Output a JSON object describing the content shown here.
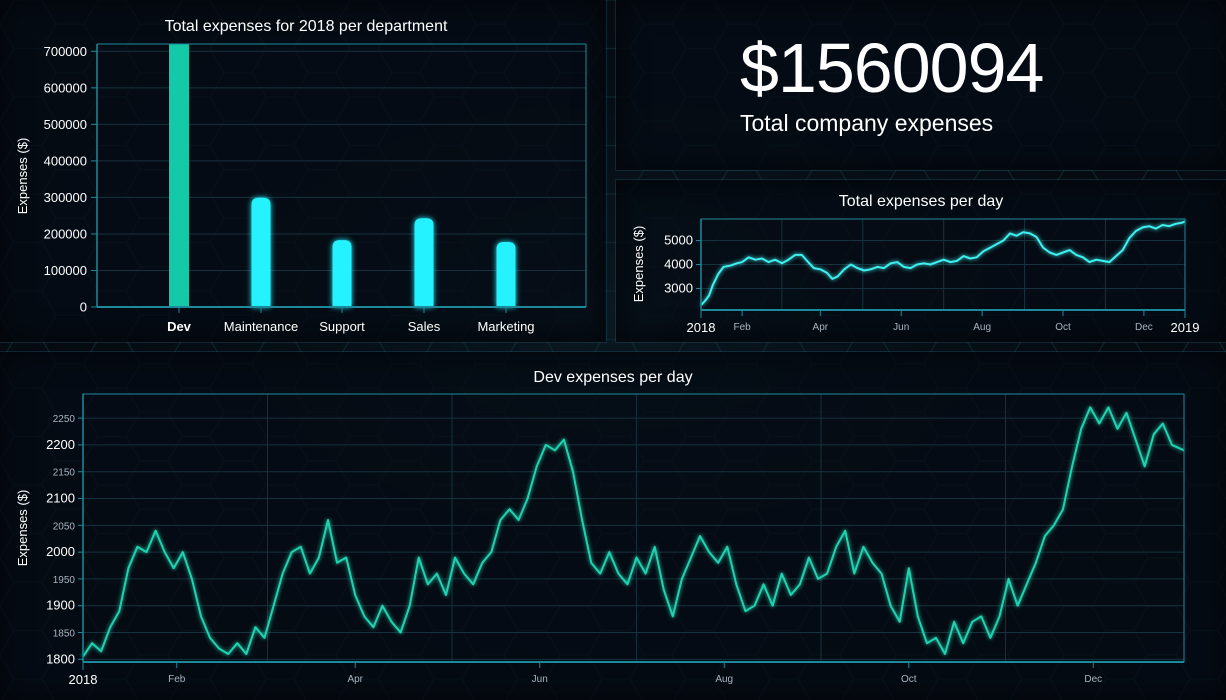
{
  "kpi": {
    "value": "$1560094",
    "label": "Total company expenses"
  },
  "colors": {
    "dev_bar": "#13c9a7",
    "bar": "#24f2ff",
    "total_line": "#3ff0f0",
    "dev_line": "#1fd3b1",
    "axis": "#1d8a9c",
    "grid": "#16323d"
  },
  "chart_data": [
    {
      "type": "bar",
      "title": "Total expenses for 2018 per department",
      "ylabel": "Expenses ($)",
      "xlabel": "",
      "categories": [
        "Dev",
        "Maintenance",
        "Support",
        "Sales",
        "Marketing"
      ],
      "highlighted_category": "Dev",
      "values": [
        720000,
        299000,
        183000,
        243000,
        178000
      ],
      "ylim": [
        0,
        720000
      ],
      "yticks": [
        0,
        100000,
        200000,
        300000,
        400000,
        500000,
        600000,
        700000
      ],
      "grid": true
    },
    {
      "type": "line",
      "title": "Total expenses per day",
      "ylabel": "Expenses ($)",
      "xlabel": "",
      "x_range": [
        "2018-01-01",
        "2019-01-01"
      ],
      "ylim": [
        2100,
        5900
      ],
      "yticks": [
        3000,
        4000,
        5000
      ],
      "major_ticks": [
        {
          "label": "2018",
          "date": "2018-01-01"
        },
        {
          "label": "2019",
          "date": "2019-01-01"
        }
      ],
      "minor_ticks": [
        {
          "label": "Feb",
          "date": "2018-02-01"
        },
        {
          "label": "Apr",
          "date": "2018-04-01"
        },
        {
          "label": "Jun",
          "date": "2018-06-01"
        },
        {
          "label": "Aug",
          "date": "2018-08-01"
        },
        {
          "label": "Oct",
          "date": "2018-10-01"
        },
        {
          "label": "Dec",
          "date": "2018-12-01"
        }
      ],
      "grid": true,
      "points": [
        [
          "2018-01-01",
          2300
        ],
        [
          "2018-01-04",
          2480
        ],
        [
          "2018-01-07",
          2700
        ],
        [
          "2018-01-10",
          3150
        ],
        [
          "2018-01-14",
          3600
        ],
        [
          "2018-01-18",
          3900
        ],
        [
          "2018-01-23",
          3950
        ],
        [
          "2018-01-28",
          4050
        ],
        [
          "2018-02-01",
          4100
        ],
        [
          "2018-02-06",
          4300
        ],
        [
          "2018-02-11",
          4200
        ],
        [
          "2018-02-16",
          4250
        ],
        [
          "2018-02-21",
          4100
        ],
        [
          "2018-02-26",
          4200
        ],
        [
          "2018-03-03",
          4050
        ],
        [
          "2018-03-08",
          4200
        ],
        [
          "2018-03-13",
          4400
        ],
        [
          "2018-03-18",
          4400
        ],
        [
          "2018-03-22",
          4150
        ],
        [
          "2018-03-27",
          3850
        ],
        [
          "2018-04-01",
          3800
        ],
        [
          "2018-04-06",
          3650
        ],
        [
          "2018-04-10",
          3400
        ],
        [
          "2018-04-14",
          3500
        ],
        [
          "2018-04-19",
          3800
        ],
        [
          "2018-04-24",
          4000
        ],
        [
          "2018-04-29",
          3850
        ],
        [
          "2018-05-04",
          3750
        ],
        [
          "2018-05-09",
          3800
        ],
        [
          "2018-05-14",
          3900
        ],
        [
          "2018-05-19",
          3850
        ],
        [
          "2018-05-24",
          4050
        ],
        [
          "2018-05-29",
          4100
        ],
        [
          "2018-06-03",
          3900
        ],
        [
          "2018-06-08",
          3850
        ],
        [
          "2018-06-13",
          4000
        ],
        [
          "2018-06-18",
          4050
        ],
        [
          "2018-06-23",
          4000
        ],
        [
          "2018-06-28",
          4100
        ],
        [
          "2018-07-03",
          4200
        ],
        [
          "2018-07-08",
          4100
        ],
        [
          "2018-07-13",
          4150
        ],
        [
          "2018-07-18",
          4350
        ],
        [
          "2018-07-23",
          4250
        ],
        [
          "2018-07-28",
          4300
        ],
        [
          "2018-08-02",
          4550
        ],
        [
          "2018-08-07",
          4700
        ],
        [
          "2018-08-12",
          4850
        ],
        [
          "2018-08-17",
          5000
        ],
        [
          "2018-08-22",
          5300
        ],
        [
          "2018-08-27",
          5200
        ],
        [
          "2018-09-01",
          5350
        ],
        [
          "2018-09-06",
          5300
        ],
        [
          "2018-09-11",
          5150
        ],
        [
          "2018-09-16",
          4700
        ],
        [
          "2018-09-21",
          4500
        ],
        [
          "2018-09-26",
          4400
        ],
        [
          "2018-10-01",
          4500
        ],
        [
          "2018-10-06",
          4600
        ],
        [
          "2018-10-11",
          4400
        ],
        [
          "2018-10-16",
          4300
        ],
        [
          "2018-10-21",
          4100
        ],
        [
          "2018-10-26",
          4200
        ],
        [
          "2018-10-31",
          4150
        ],
        [
          "2018-11-05",
          4100
        ],
        [
          "2018-11-10",
          4350
        ],
        [
          "2018-11-15",
          4600
        ],
        [
          "2018-11-20",
          5100
        ],
        [
          "2018-11-25",
          5400
        ],
        [
          "2018-11-30",
          5550
        ],
        [
          "2018-12-05",
          5600
        ],
        [
          "2018-12-10",
          5500
        ],
        [
          "2018-12-15",
          5650
        ],
        [
          "2018-12-20",
          5600
        ],
        [
          "2018-12-25",
          5700
        ],
        [
          "2018-12-30",
          5750
        ],
        [
          "2019-01-01",
          5800
        ]
      ]
    },
    {
      "type": "line",
      "title": "Dev expenses per day",
      "ylabel": "Expenses ($)",
      "xlabel": "",
      "x_range": [
        "2018-01-01",
        "2018-12-31"
      ],
      "ylim": [
        1795,
        2295
      ],
      "yticks": [
        1800,
        1850,
        1900,
        1950,
        2000,
        2050,
        2100,
        2150,
        2200,
        2250
      ],
      "major_yticks": [
        1800,
        1900,
        2000,
        2100,
        2200
      ],
      "major_ticks": [
        {
          "label": "2018",
          "date": "2018-01-01"
        }
      ],
      "minor_ticks": [
        {
          "label": "Feb",
          "date": "2018-02-01"
        },
        {
          "label": "Apr",
          "date": "2018-04-01"
        },
        {
          "label": "Jun",
          "date": "2018-06-01"
        },
        {
          "label": "Aug",
          "date": "2018-08-01"
        },
        {
          "label": "Oct",
          "date": "2018-10-01"
        },
        {
          "label": "Dec",
          "date": "2018-12-01"
        }
      ],
      "grid": true,
      "points": [
        [
          "2018-01-01",
          1805
        ],
        [
          "2018-01-04",
          1830
        ],
        [
          "2018-01-07",
          1815
        ],
        [
          "2018-01-10",
          1860
        ],
        [
          "2018-01-13",
          1890
        ],
        [
          "2018-01-16",
          1970
        ],
        [
          "2018-01-19",
          2010
        ],
        [
          "2018-01-22",
          2000
        ],
        [
          "2018-01-25",
          2040
        ],
        [
          "2018-01-28",
          2000
        ],
        [
          "2018-01-31",
          1970
        ],
        [
          "2018-02-03",
          2000
        ],
        [
          "2018-02-06",
          1950
        ],
        [
          "2018-02-09",
          1880
        ],
        [
          "2018-02-12",
          1840
        ],
        [
          "2018-02-15",
          1820
        ],
        [
          "2018-02-18",
          1810
        ],
        [
          "2018-02-21",
          1830
        ],
        [
          "2018-02-24",
          1810
        ],
        [
          "2018-02-27",
          1860
        ],
        [
          "2018-03-02",
          1840
        ],
        [
          "2018-03-05",
          1900
        ],
        [
          "2018-03-08",
          1960
        ],
        [
          "2018-03-11",
          2000
        ],
        [
          "2018-03-14",
          2010
        ],
        [
          "2018-03-17",
          1960
        ],
        [
          "2018-03-20",
          1990
        ],
        [
          "2018-03-23",
          2060
        ],
        [
          "2018-03-26",
          1980
        ],
        [
          "2018-03-29",
          1990
        ],
        [
          "2018-04-01",
          1920
        ],
        [
          "2018-04-04",
          1880
        ],
        [
          "2018-04-07",
          1860
        ],
        [
          "2018-04-10",
          1900
        ],
        [
          "2018-04-13",
          1870
        ],
        [
          "2018-04-16",
          1850
        ],
        [
          "2018-04-19",
          1900
        ],
        [
          "2018-04-22",
          1990
        ],
        [
          "2018-04-25",
          1940
        ],
        [
          "2018-04-28",
          1960
        ],
        [
          "2018-05-01",
          1920
        ],
        [
          "2018-05-04",
          1990
        ],
        [
          "2018-05-07",
          1960
        ],
        [
          "2018-05-10",
          1940
        ],
        [
          "2018-05-13",
          1980
        ],
        [
          "2018-05-16",
          2000
        ],
        [
          "2018-05-19",
          2060
        ],
        [
          "2018-05-22",
          2080
        ],
        [
          "2018-05-25",
          2060
        ],
        [
          "2018-05-28",
          2100
        ],
        [
          "2018-05-31",
          2160
        ],
        [
          "2018-06-03",
          2200
        ],
        [
          "2018-06-06",
          2190
        ],
        [
          "2018-06-09",
          2210
        ],
        [
          "2018-06-12",
          2150
        ],
        [
          "2018-06-15",
          2060
        ],
        [
          "2018-06-18",
          1980
        ],
        [
          "2018-06-21",
          1960
        ],
        [
          "2018-06-24",
          2000
        ],
        [
          "2018-06-27",
          1960
        ],
        [
          "2018-06-30",
          1940
        ],
        [
          "2018-07-03",
          1990
        ],
        [
          "2018-07-06",
          1960
        ],
        [
          "2018-07-09",
          2010
        ],
        [
          "2018-07-12",
          1930
        ],
        [
          "2018-07-15",
          1880
        ],
        [
          "2018-07-18",
          1950
        ],
        [
          "2018-07-21",
          1990
        ],
        [
          "2018-07-24",
          2030
        ],
        [
          "2018-07-27",
          2000
        ],
        [
          "2018-07-30",
          1980
        ],
        [
          "2018-08-02",
          2010
        ],
        [
          "2018-08-05",
          1940
        ],
        [
          "2018-08-08",
          1890
        ],
        [
          "2018-08-11",
          1900
        ],
        [
          "2018-08-14",
          1940
        ],
        [
          "2018-08-17",
          1900
        ],
        [
          "2018-08-20",
          1960
        ],
        [
          "2018-08-23",
          1920
        ],
        [
          "2018-08-26",
          1940
        ],
        [
          "2018-08-29",
          1990
        ],
        [
          "2018-09-01",
          1950
        ],
        [
          "2018-09-04",
          1960
        ],
        [
          "2018-09-07",
          2010
        ],
        [
          "2018-09-10",
          2040
        ],
        [
          "2018-09-13",
          1960
        ],
        [
          "2018-09-16",
          2010
        ],
        [
          "2018-09-19",
          1980
        ],
        [
          "2018-09-22",
          1960
        ],
        [
          "2018-09-25",
          1900
        ],
        [
          "2018-09-28",
          1870
        ],
        [
          "2018-10-01",
          1970
        ],
        [
          "2018-10-04",
          1880
        ],
        [
          "2018-10-07",
          1830
        ],
        [
          "2018-10-10",
          1840
        ],
        [
          "2018-10-13",
          1810
        ],
        [
          "2018-10-16",
          1870
        ],
        [
          "2018-10-19",
          1830
        ],
        [
          "2018-10-22",
          1870
        ],
        [
          "2018-10-25",
          1880
        ],
        [
          "2018-10-28",
          1840
        ],
        [
          "2018-10-31",
          1880
        ],
        [
          "2018-11-03",
          1950
        ],
        [
          "2018-11-06",
          1900
        ],
        [
          "2018-11-09",
          1940
        ],
        [
          "2018-11-12",
          1980
        ],
        [
          "2018-11-15",
          2030
        ],
        [
          "2018-11-18",
          2050
        ],
        [
          "2018-11-21",
          2080
        ],
        [
          "2018-11-24",
          2160
        ],
        [
          "2018-11-27",
          2230
        ],
        [
          "2018-11-30",
          2270
        ],
        [
          "2018-12-03",
          2240
        ],
        [
          "2018-12-06",
          2270
        ],
        [
          "2018-12-09",
          2230
        ],
        [
          "2018-12-12",
          2260
        ],
        [
          "2018-12-15",
          2210
        ],
        [
          "2018-12-18",
          2160
        ],
        [
          "2018-12-21",
          2220
        ],
        [
          "2018-12-24",
          2240
        ],
        [
          "2018-12-27",
          2200
        ],
        [
          "2018-12-31",
          2190
        ]
      ]
    }
  ]
}
